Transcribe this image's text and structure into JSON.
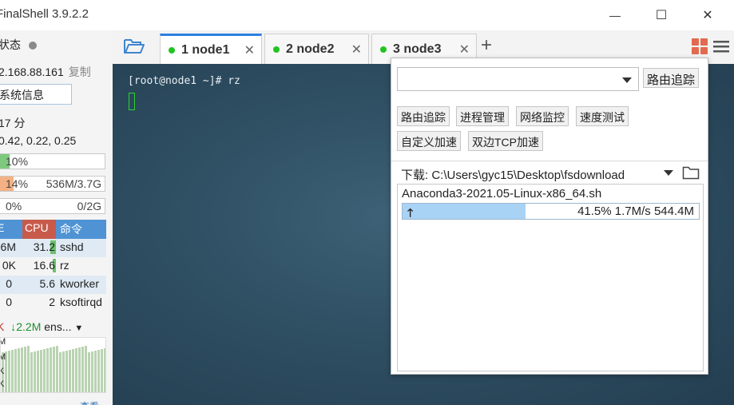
{
  "window": {
    "title": "FinalShell 3.9.2.2",
    "minimize": "—",
    "maximize": "☐",
    "close": "✕"
  },
  "sidebar": {
    "status_label": "状态",
    "ip": "2.168.88.161",
    "copy_label": "复制",
    "sysinfo_button": "系统信息",
    "uptime": "17 分",
    "load": "0.42, 0.22, 0.25",
    "cpu": {
      "percent": 10,
      "label": "10%",
      "color": "#7fc97f"
    },
    "mem": {
      "percent": 14,
      "label": "14%",
      "detail": "536M/3.7G",
      "color": "#f4b183"
    },
    "swap": {
      "percent": 0,
      "label": "0%",
      "detail": "0/2G",
      "color": "#7fc97f"
    },
    "process_table": {
      "headers": [
        "E",
        "CPU",
        "命令"
      ],
      "rows": [
        {
          "mem": "6M",
          "cpu": "31.2",
          "cmd": "sshd"
        },
        {
          "mem": "0K",
          "cpu": "16.6",
          "cmd": "rz"
        },
        {
          "mem": "0",
          "cpu": "5.6",
          "cmd": "kworker"
        },
        {
          "mem": "0",
          "cpu": "2",
          "cmd": "ksoftirqd"
        }
      ]
    },
    "network": {
      "up_arrow": "K",
      "down_label": "2.2M",
      "iface": "ens..."
    },
    "graph_labels": [
      "M",
      "M",
      "M",
      "K",
      "K"
    ],
    "bottom_text": "查看"
  },
  "tabs": [
    {
      "label": "1 node1",
      "active": true
    },
    {
      "label": "2 node2",
      "active": false
    },
    {
      "label": "3 node3",
      "active": false
    }
  ],
  "terminal": {
    "line1": "[root@node1 ~]# rz"
  },
  "popup": {
    "trace_button": "路由追踪",
    "tools": [
      "路由追踪",
      "进程管理",
      "网络监控",
      "速度测试"
    ],
    "tools2": [
      "自定义加速",
      "双边TCP加速"
    ],
    "download_path": "下载: C:\\Users\\gyc15\\Desktop\\fsdownload",
    "file": {
      "name": "Anaconda3-2021.05-Linux-x86_64.sh",
      "progress": 41.5,
      "status": "41.5% 1.7M/s 544.4M"
    }
  }
}
